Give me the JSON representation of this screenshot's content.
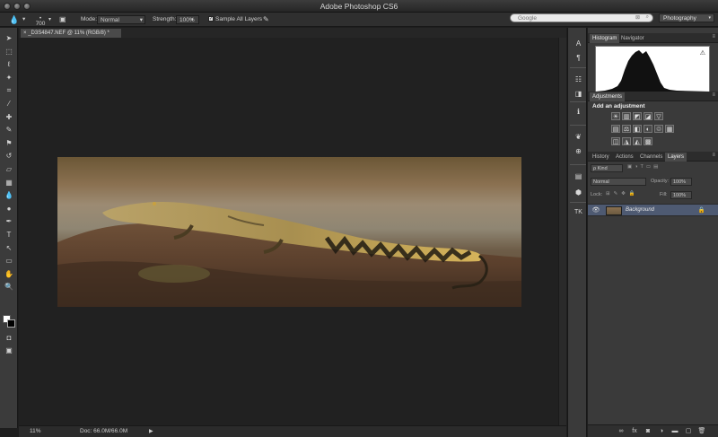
{
  "window": {
    "title": "Adobe Photoshop CS6"
  },
  "search": {
    "placeholder": "Google",
    "clear_glyph": "⊠",
    "submit_glyph": "⌕"
  },
  "workspace": {
    "selected": "Photography",
    "chevron": "▾"
  },
  "options_bar": {
    "brush_size": "700",
    "mode_label": "Mode:",
    "mode_value": "Normal",
    "strength_label": "Strength:",
    "strength_value": "100%",
    "sample_all_layers_label": "Sample All Layers",
    "sample_all_layers_checked": true,
    "check_glyph": "✓",
    "dropdown_glyph": "▾"
  },
  "tools": [
    {
      "name": "move-tool-icon",
      "glyph": "➤"
    },
    {
      "name": "marquee-tool-icon",
      "glyph": "⬚"
    },
    {
      "name": "lasso-tool-icon",
      "glyph": "ℓ"
    },
    {
      "name": "quick-select-tool-icon",
      "glyph": "✦"
    },
    {
      "name": "crop-tool-icon",
      "glyph": "⌗"
    },
    {
      "name": "eyedropper-tool-icon",
      "glyph": "⁄"
    },
    {
      "name": "healing-brush-tool-icon",
      "glyph": "✚"
    },
    {
      "name": "brush-tool-icon",
      "glyph": "✎"
    },
    {
      "name": "clone-stamp-tool-icon",
      "glyph": "⚑"
    },
    {
      "name": "history-brush-tool-icon",
      "glyph": "↺"
    },
    {
      "name": "eraser-tool-icon",
      "glyph": "▱"
    },
    {
      "name": "gradient-tool-icon",
      "glyph": "▦"
    },
    {
      "name": "blur-tool-icon",
      "glyph": "💧"
    },
    {
      "name": "dodge-tool-icon",
      "glyph": "●"
    },
    {
      "name": "pen-tool-icon",
      "glyph": "✒"
    },
    {
      "name": "type-tool-icon",
      "glyph": "T"
    },
    {
      "name": "path-select-tool-icon",
      "glyph": "↖"
    },
    {
      "name": "shape-tool-icon",
      "glyph": "▭"
    },
    {
      "name": "hand-tool-icon",
      "glyph": "✋"
    },
    {
      "name": "zoom-tool-icon",
      "glyph": "🔍"
    }
  ],
  "document": {
    "tab_title": "_D3S4847.NEF @ 11% (RGB/8) *",
    "tab_close_glyph": "×"
  },
  "status": {
    "zoom": "11%",
    "doc_info": "Doc: 66.0M/66.0M",
    "arrow_glyph": "▶"
  },
  "dock_icons": [
    {
      "name": "character-icon",
      "glyph": "A"
    },
    {
      "name": "paragraph-icon",
      "glyph": "¶"
    },
    {
      "name": "tool-presets-icon",
      "glyph": "☷"
    },
    {
      "name": "layer-comps-icon",
      "glyph": "◨"
    },
    {
      "name": "info-icon",
      "glyph": "ℹ"
    },
    {
      "name": "brush-presets-icon",
      "glyph": "❦"
    },
    {
      "name": "clone-source-icon",
      "glyph": "⊕"
    },
    {
      "name": "brush-settings-icon",
      "glyph": "▤"
    },
    {
      "name": "3d-icon",
      "glyph": "⬢"
    },
    {
      "name": "plugin-tk-icon",
      "glyph": "TK"
    }
  ],
  "panel_top": {
    "tabs": [
      "Histogram",
      "Navigator"
    ],
    "active": 0,
    "warning_glyph": "⚠",
    "menu_glyph": "≡"
  },
  "adjustments": {
    "tab": "Adjustments",
    "heading": "Add an adjustment",
    "row1": [
      "☀",
      "▥",
      "◩",
      "◪",
      "▽"
    ],
    "row2": [
      "▤",
      "⚖",
      "◧",
      "◐",
      "♲",
      "▦"
    ],
    "row3": [
      "◫",
      "◮",
      "◭",
      "▩"
    ]
  },
  "layers_panel": {
    "tabs": [
      "History",
      "Actions",
      "Channels",
      "Layers"
    ],
    "active": 3,
    "kind_label": "ρ Kind",
    "blend_mode": "Normal",
    "opacity_label": "Opacity:",
    "opacity_value": "100%",
    "lock_label": "Lock:",
    "fill_label": "Fill:",
    "fill_value": "100%",
    "layer_name": "Background",
    "footer_icons": [
      "∞",
      "fx",
      "◙",
      "◑",
      "▬",
      "▢",
      "🗑"
    ],
    "eye_glyph": "👁",
    "lock_glyph": "🔒"
  }
}
